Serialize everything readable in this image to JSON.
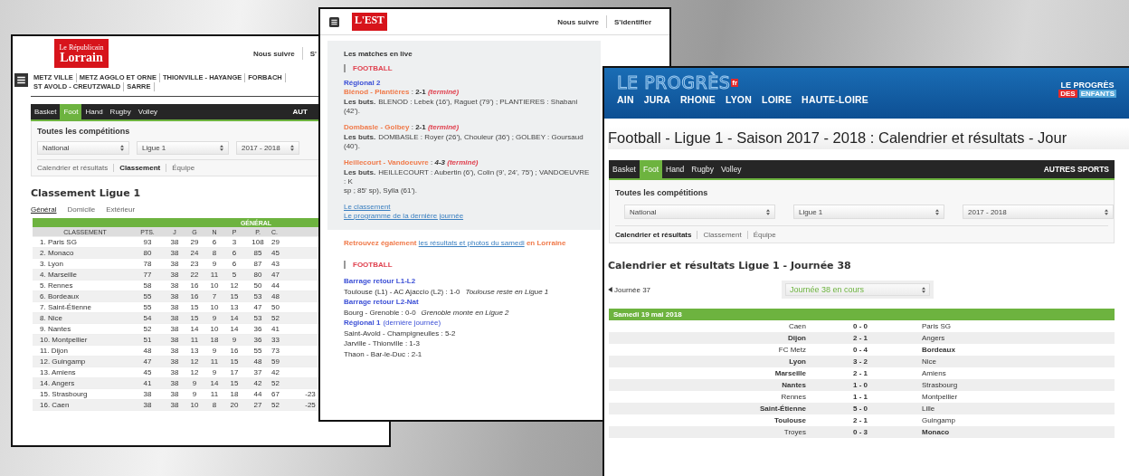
{
  "lorrain_page": {
    "logo": [
      "Le Républicain",
      "Lorrain"
    ],
    "header_links": [
      "Nous suivre",
      "S'"
    ],
    "nav": [
      "METZ VILLE",
      "METZ AGGLO ET ORNE",
      "THIONVILLE - HAYANGE",
      "FORBACH",
      "ST AVOLD - CREUTZWALD",
      "SARRE"
    ],
    "sport_tabs": [
      {
        "label": "Basket",
        "selected": false
      },
      {
        "label": "Foot",
        "selected": true
      },
      {
        "label": "Hand",
        "selected": false
      },
      {
        "label": "Rugby",
        "selected": false
      },
      {
        "label": "Volley",
        "selected": false
      }
    ],
    "other_sports": "AUT",
    "panel": {
      "title": "Toutes les compétitions",
      "selects": [
        "National",
        "Ligue 1",
        "2017 - 2018"
      ],
      "subtabs": [
        {
          "label": "Calendrier et résultats",
          "selected": false
        },
        {
          "label": "Classement",
          "selected": true
        },
        {
          "label": "Équipe",
          "selected": false
        }
      ]
    },
    "heading": "Classement Ligue 1",
    "view_tabs": [
      {
        "label": "Général",
        "selected": true
      },
      {
        "label": "Domicile",
        "selected": false
      },
      {
        "label": "Extérieur",
        "selected": false
      }
    ],
    "table": {
      "group_heading": "GÉNÉRAL",
      "columns": [
        "CLASSEMENT",
        "PTS.",
        "J",
        "G",
        "N",
        "P",
        "P.",
        "C."
      ],
      "rows": [
        {
          "cells": [
            "1. Paris SG",
            "93",
            "38",
            "29",
            "6",
            "3",
            "108",
            "29"
          ]
        },
        {
          "cells": [
            "2. Monaco",
            "80",
            "38",
            "24",
            "8",
            "6",
            "85",
            "45"
          ]
        },
        {
          "cells": [
            "3. Lyon",
            "78",
            "38",
            "23",
            "9",
            "6",
            "87",
            "43"
          ]
        },
        {
          "cells": [
            "4. Marseille",
            "77",
            "38",
            "22",
            "11",
            "5",
            "80",
            "47"
          ]
        },
        {
          "cells": [
            "5. Rennes",
            "58",
            "38",
            "16",
            "10",
            "12",
            "50",
            "44"
          ]
        },
        {
          "cells": [
            "6. Bordeaux",
            "55",
            "38",
            "16",
            "7",
            "15",
            "53",
            "48"
          ]
        },
        {
          "cells": [
            "7. Saint-Étienne",
            "55",
            "38",
            "15",
            "10",
            "13",
            "47",
            "50"
          ]
        },
        {
          "cells": [
            "8. Nice",
            "54",
            "38",
            "15",
            "9",
            "14",
            "53",
            "52"
          ]
        },
        {
          "cells": [
            "9. Nantes",
            "52",
            "38",
            "14",
            "10",
            "14",
            "36",
            "41"
          ]
        },
        {
          "cells": [
            "10. Montpellier",
            "51",
            "38",
            "11",
            "18",
            "9",
            "36",
            "33"
          ]
        },
        {
          "cells": [
            "11. Dijon",
            "48",
            "38",
            "13",
            "9",
            "16",
            "55",
            "73"
          ]
        },
        {
          "cells": [
            "12. Guingamp",
            "47",
            "38",
            "12",
            "11",
            "15",
            "48",
            "59"
          ]
        },
        {
          "cells": [
            "13. Amiens",
            "45",
            "38",
            "12",
            "9",
            "17",
            "37",
            "42"
          ]
        },
        {
          "cells": [
            "14. Angers",
            "41",
            "38",
            "9",
            "14",
            "15",
            "42",
            "52"
          ]
        },
        {
          "cells": [
            "15. Strasbourg",
            "38",
            "38",
            "9",
            "11",
            "18",
            "44",
            "67"
          ],
          "column_9": "-23"
        },
        {
          "cells": [
            "16. Caen",
            "38",
            "38",
            "10",
            "8",
            "20",
            "27",
            "52"
          ],
          "column_9": "-25"
        }
      ]
    }
  },
  "est_page": {
    "logo": "L'EST",
    "header_links": [
      "Nous suivre",
      "S'identifier"
    ],
    "live": {
      "title": "Les matches en live",
      "section": "FOOTBALL",
      "competition": "Régional 2",
      "matches": [
        {
          "teams": "Blénod - Plantières",
          "separator": ":",
          "score": "2-1",
          "status": "(terminé)",
          "scorers_label": "Les buts.",
          "scorers_lines": [
            "BLENOD : Lebek (16'), Raguet (79') ; PLANTIERES : Shabani (42')."
          ]
        },
        {
          "teams": "Dombasle - Golbey",
          "separator": ":",
          "score": "2-1",
          "status": "(terminé)",
          "scorers_label": "Les buts.",
          "scorers_lines": [
            "DOMBASLE : Royer (26'), Chouleur (36') ; GOLBEY : Goursaud (40')."
          ]
        },
        {
          "teams": "Heillecourt - Vandoeuvre",
          "separator": ":",
          "score": "4-3",
          "status": "(terminé)",
          "scorers_label": "Les buts.",
          "scorers_lines": [
            "HEILLECOURT : Aubertin (6'), Colin (9', 24', 75') ; VANDOEUVRE : K",
            "sp ; 85' sp), Sylla (61')."
          ]
        }
      ],
      "links": [
        "Le classement",
        "Le programme de la dernière journée"
      ]
    },
    "promo": {
      "before": "Retrouvez également",
      "link": "les résultats et photos du samedi",
      "after": "en Lorraine"
    },
    "results": {
      "section": "FOOTBALL",
      "items": [
        {
          "kind": "heading",
          "text": "Barrage retour L1-L2"
        },
        {
          "kind": "result",
          "text": "Toulouse (L1) - AC Ajaccio (L2) : 1-0",
          "note": "Toulouse reste en Ligue 1"
        },
        {
          "kind": "heading",
          "text": "Barrage retour L2-Nat"
        },
        {
          "kind": "result",
          "text": "Bourg - Grenoble : 0-0",
          "note": "Grenoble monte en Ligue 2"
        },
        {
          "kind": "heading",
          "text": "Régional 1",
          "note": "(dernière journée)"
        },
        {
          "kind": "result",
          "text": "Saint-Avold - Champigneulles : 5-2"
        },
        {
          "kind": "result",
          "text": "Jarville - Thionville : 1-3"
        },
        {
          "kind": "result",
          "text": "Thaon - Bar-le-Duc : 2-1"
        }
      ]
    }
  },
  "progres_page": {
    "logo": {
      "name": "LE PROGRÈS",
      "suffix": "fr"
    },
    "regions": [
      "AIN",
      "JURA",
      "RHONE",
      "LYON",
      "LOIRE",
      "HAUTE-LOIRE"
    ],
    "kids_logo": [
      "LE PROGRÈS",
      "DES",
      "ENFANTS"
    ],
    "title": "Football - Ligue 1 - Saison 2017 - 2018 : Calendrier et résultats - Jour",
    "sport_tabs": [
      {
        "label": "Basket",
        "selected": false
      },
      {
        "label": "Foot",
        "selected": true
      },
      {
        "label": "Hand",
        "selected": false
      },
      {
        "label": "Rugby",
        "selected": false
      },
      {
        "label": "Volley",
        "selected": false
      }
    ],
    "other_sports": "AUTRES SPORTS",
    "panel": {
      "title": "Toutes les compétitions",
      "selects": [
        "National",
        "Ligue 1",
        "2017 - 2018"
      ],
      "subtabs": [
        {
          "label": "Calendrier et résultats",
          "selected": true
        },
        {
          "label": "Classement",
          "selected": false
        },
        {
          "label": "Équipe",
          "selected": false
        }
      ]
    },
    "heading": "Calendrier et résultats Ligue 1 - Journée 38",
    "previous": "Journée 37",
    "round_select": "Journée 38 en cours",
    "date": "Samedi 19 mai 2018",
    "matches": [
      {
        "home": "Caen",
        "score": "0 - 0",
        "away": "Paris SG",
        "home_won": false,
        "away_won": false
      },
      {
        "home": "Dijon",
        "score": "2 - 1",
        "away": "Angers",
        "home_won": true,
        "away_won": false
      },
      {
        "home": "FC Metz",
        "score": "0 - 4",
        "away": "Bordeaux",
        "home_won": false,
        "away_won": true
      },
      {
        "home": "Lyon",
        "score": "3 - 2",
        "away": "Nice",
        "home_won": true,
        "away_won": false
      },
      {
        "home": "Marseille",
        "score": "2 - 1",
        "away": "Amiens",
        "home_won": true,
        "away_won": false
      },
      {
        "home": "Nantes",
        "score": "1 - 0",
        "away": "Strasbourg",
        "home_won": true,
        "away_won": false
      },
      {
        "home": "Rennes",
        "score": "1 - 1",
        "away": "Montpellier",
        "home_won": false,
        "away_won": false
      },
      {
        "home": "Saint-Étienne",
        "score": "5 - 0",
        "away": "Lille",
        "home_won": true,
        "away_won": false
      },
      {
        "home": "Toulouse",
        "score": "2 - 1",
        "away": "Guingamp",
        "home_won": true,
        "away_won": false
      },
      {
        "home": "Troyes",
        "score": "0 - 3",
        "away": "Monaco",
        "home_won": false,
        "away_won": true
      }
    ]
  }
}
